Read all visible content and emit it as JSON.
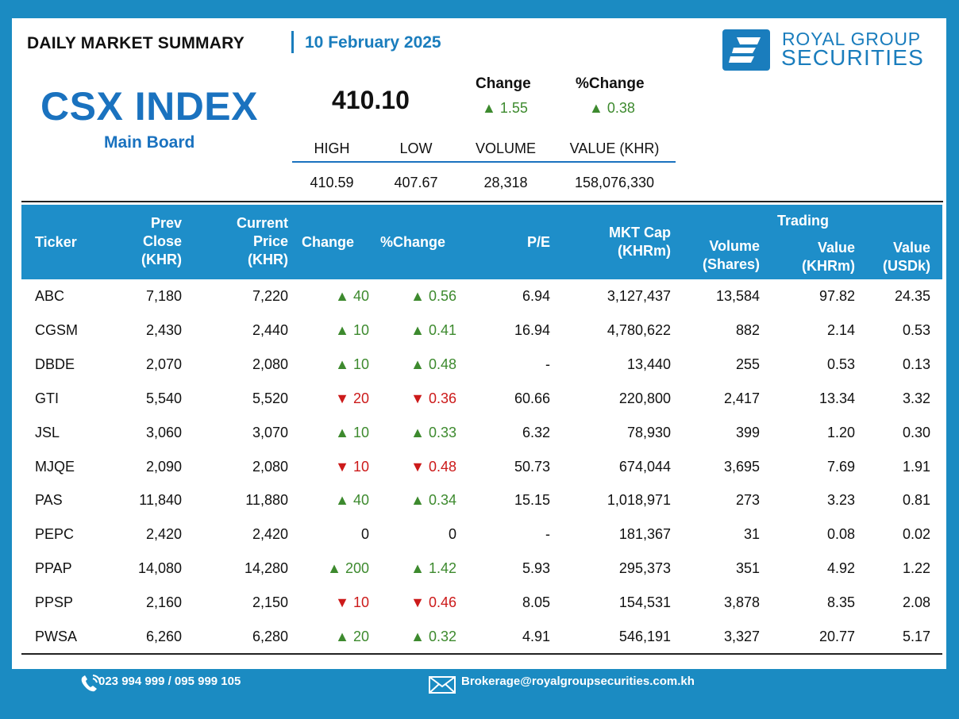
{
  "header": {
    "title": "DAILY MARKET SUMMARY",
    "date": "10 February 2025",
    "brand_line1": "ROYAL GROUP",
    "brand_line2": "SECURITIES"
  },
  "index": {
    "name": "CSX INDEX",
    "board": "Main Board",
    "value": "410.10",
    "change_label": "Change",
    "change_value": "▲ 1.55",
    "pct_change_label": "%Change",
    "pct_change_value": "▲ 0.38",
    "stats_headers": [
      "HIGH",
      "LOW",
      "VOLUME",
      "VALUE (KHR)"
    ],
    "stats_values": [
      "410.59",
      "407.67",
      "28,318",
      "158,076,330"
    ]
  },
  "table": {
    "headers": {
      "ticker": "Ticker",
      "prev_close": [
        "Prev",
        "Close",
        "(KHR)"
      ],
      "current_price": [
        "Current",
        "Price",
        "(KHR)"
      ],
      "change": "Change",
      "pct_change": "%Change",
      "pe": "P/E",
      "mkt_cap": [
        "MKT Cap",
        "(KHRm)"
      ],
      "trading": "Trading",
      "volume": [
        "Volume",
        "(Shares)"
      ],
      "value_khr": [
        "Value",
        "(KHRm)"
      ],
      "value_usd": [
        "Value",
        "(USDk)"
      ]
    },
    "rows": [
      {
        "ticker": "ABC",
        "prev": "7,180",
        "cur": "7,220",
        "chg": "▲ 40",
        "pct": "▲ 0.56",
        "dir": "up",
        "pe": "6.94",
        "cap": "3,127,437",
        "vol": "13,584",
        "vk": "97.82",
        "vu": "24.35"
      },
      {
        "ticker": "CGSM",
        "prev": "2,430",
        "cur": "2,440",
        "chg": "▲ 10",
        "pct": "▲ 0.41",
        "dir": "up",
        "pe": "16.94",
        "cap": "4,780,622",
        "vol": "882",
        "vk": "2.14",
        "vu": "0.53"
      },
      {
        "ticker": "DBDE",
        "prev": "2,070",
        "cur": "2,080",
        "chg": "▲ 10",
        "pct": "▲ 0.48",
        "dir": "up",
        "pe": "-",
        "cap": "13,440",
        "vol": "255",
        "vk": "0.53",
        "vu": "0.13"
      },
      {
        "ticker": "GTI",
        "prev": "5,540",
        "cur": "5,520",
        "chg": "▼ 20",
        "pct": "▼ 0.36",
        "dir": "down",
        "pe": "60.66",
        "cap": "220,800",
        "vol": "2,417",
        "vk": "13.34",
        "vu": "3.32"
      },
      {
        "ticker": "JSL",
        "prev": "3,060",
        "cur": "3,070",
        "chg": "▲ 10",
        "pct": "▲ 0.33",
        "dir": "up",
        "pe": "6.32",
        "cap": "78,930",
        "vol": "399",
        "vk": "1.20",
        "vu": "0.30"
      },
      {
        "ticker": "MJQE",
        "prev": "2,090",
        "cur": "2,080",
        "chg": "▼ 10",
        "pct": "▼ 0.48",
        "dir": "down",
        "pe": "50.73",
        "cap": "674,044",
        "vol": "3,695",
        "vk": "7.69",
        "vu": "1.91"
      },
      {
        "ticker": "PAS",
        "prev": "11,840",
        "cur": "11,880",
        "chg": "▲ 40",
        "pct": "▲ 0.34",
        "dir": "up",
        "pe": "15.15",
        "cap": "1,018,971",
        "vol": "273",
        "vk": "3.23",
        "vu": "0.81"
      },
      {
        "ticker": "PEPC",
        "prev": "2,420",
        "cur": "2,420",
        "chg": "0",
        "pct": "0",
        "dir": "flat",
        "pe": "-",
        "cap": "181,367",
        "vol": "31",
        "vk": "0.08",
        "vu": "0.02"
      },
      {
        "ticker": "PPAP",
        "prev": "14,080",
        "cur": "14,280",
        "chg": "▲ 200",
        "pct": "▲ 1.42",
        "dir": "up",
        "pe": "5.93",
        "cap": "295,373",
        "vol": "351",
        "vk": "4.92",
        "vu": "1.22"
      },
      {
        "ticker": "PPSP",
        "prev": "2,160",
        "cur": "2,150",
        "chg": "▼ 10",
        "pct": "▼ 0.46",
        "dir": "down",
        "pe": "8.05",
        "cap": "154,531",
        "vol": "3,878",
        "vk": "8.35",
        "vu": "2.08"
      },
      {
        "ticker": "PWSA",
        "prev": "6,260",
        "cur": "6,280",
        "chg": "▲ 20",
        "pct": "▲ 0.32",
        "dir": "up",
        "pe": "4.91",
        "cap": "546,191",
        "vol": "3,327",
        "vk": "20.77",
        "vu": "5.17"
      }
    ]
  },
  "footer": {
    "phone": "023 994 999 / 095 999 105",
    "email": "Brokerage@royalgroupsecurities.com.kh",
    "phone_icon": "phone-icon",
    "email_icon": "envelope-icon"
  },
  "colors": {
    "brand_blue": "#1a7dbd",
    "header_bg": "#1e8ec9",
    "up": "#3d8a2e",
    "down": "#cc1a1a"
  }
}
